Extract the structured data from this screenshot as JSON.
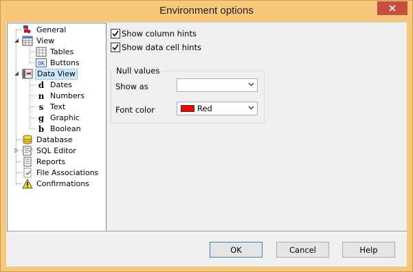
{
  "window": {
    "title": "Environment options"
  },
  "tree": {
    "items": [
      {
        "label": "General"
      },
      {
        "label": "View"
      },
      {
        "label": "Tables"
      },
      {
        "label": "Buttons",
        "icon_text": "OK"
      },
      {
        "label": "Data View"
      },
      {
        "label": "Dates",
        "icon_text": "d"
      },
      {
        "label": "Numbers",
        "icon_text": "n"
      },
      {
        "label": "Text",
        "icon_text": "s"
      },
      {
        "label": "Graphic",
        "icon_text": "g"
      },
      {
        "label": "Boolean",
        "icon_text": "b"
      },
      {
        "label": "Database"
      },
      {
        "label": "SQL Editor"
      },
      {
        "label": "Reports"
      },
      {
        "label": "File Associations"
      },
      {
        "label": "Confirmations"
      }
    ],
    "selected": "Data View"
  },
  "options": {
    "show_column_hints": {
      "label": "Show column hints",
      "checked": true
    },
    "show_data_cell_hints": {
      "label": "Show data cell hints",
      "checked": true
    }
  },
  "null_values": {
    "title": "Null values",
    "show_as_label": "Show as",
    "show_as_value": "",
    "font_color_label": "Font color",
    "font_color_value": "Red",
    "font_color_swatch": "#ff0000"
  },
  "buttons": {
    "ok": "OK",
    "cancel": "Cancel",
    "help": "Help"
  },
  "colors": {
    "title_bar": "#f7c77a",
    "close": "#c74f3f",
    "selection": "#cce8ff"
  }
}
